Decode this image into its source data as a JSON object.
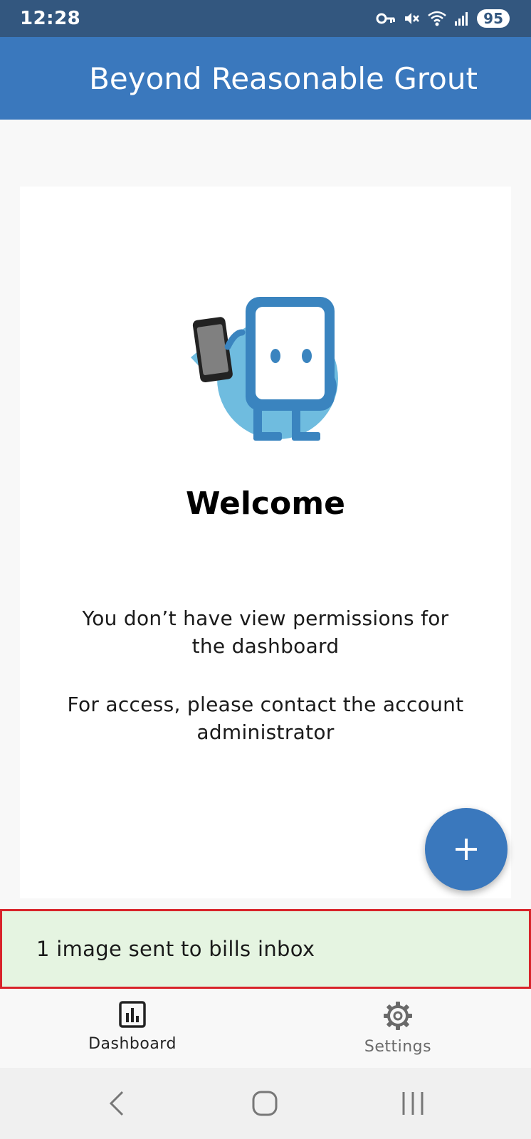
{
  "status_bar": {
    "time": "12:28",
    "battery": "95",
    "icons": [
      "vpn-key-icon",
      "mute-icon",
      "wifi-icon",
      "signal-icon",
      "battery-icon"
    ]
  },
  "header": {
    "title": "Beyond Reasonable Grout"
  },
  "card": {
    "title": "Welcome",
    "message_1": "You don’t have view permissions for the dashboard",
    "message_2": "For access, please contact the account administrator",
    "illustration": "mascot-with-phone"
  },
  "fab": {
    "icon": "plus-icon"
  },
  "toast": {
    "text": "1 image sent to bills inbox"
  },
  "bottom_nav": {
    "items": [
      {
        "label": "Dashboard",
        "icon": "bar-chart-icon",
        "active": true
      },
      {
        "label": "Settings",
        "icon": "gear-icon",
        "active": false
      }
    ]
  },
  "system_nav": {
    "buttons": [
      "back-icon",
      "home-icon",
      "recents-icon"
    ]
  },
  "colors": {
    "status_bar": "#33577f",
    "header": "#3a78bd",
    "fab": "#3a78bd",
    "toast_bg": "#e5f4e1",
    "toast_border": "#d8232a"
  }
}
